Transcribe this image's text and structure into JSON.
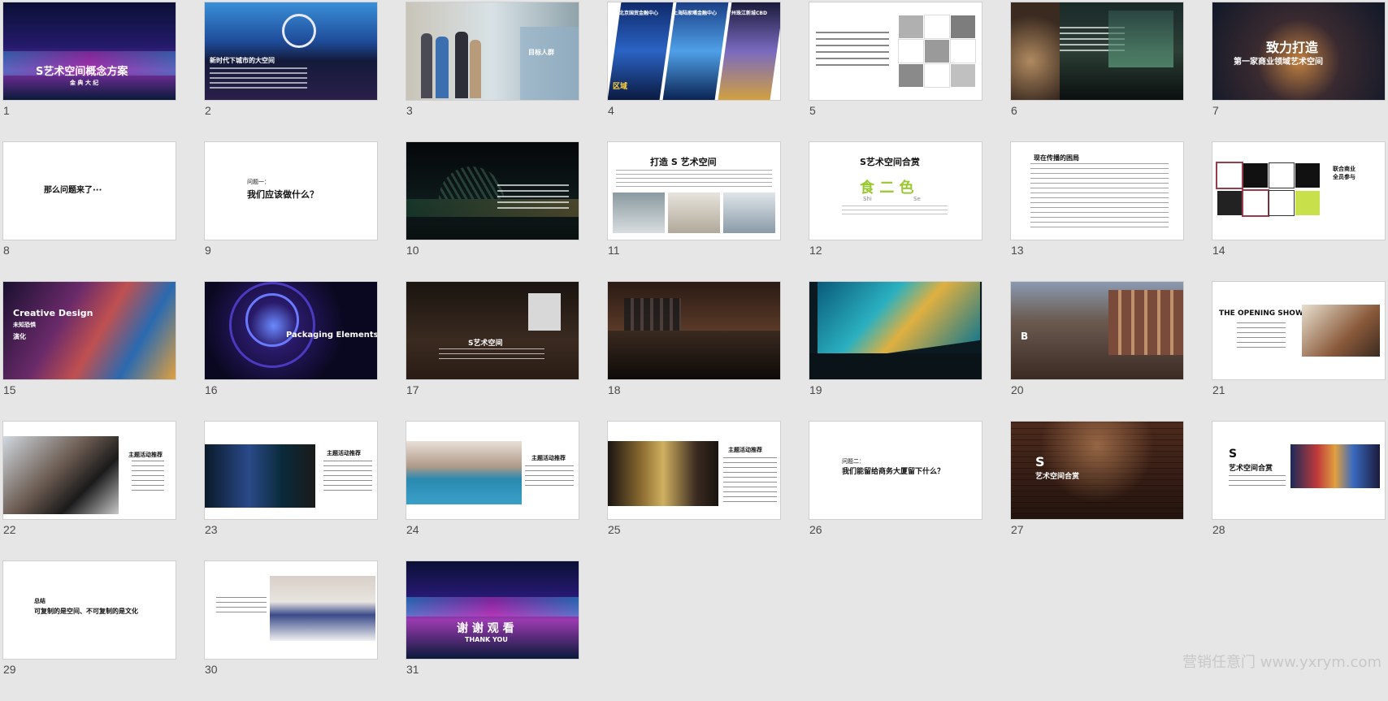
{
  "slides": [
    {
      "n": "1",
      "title": "S艺术空间概念方案",
      "sub": "金 典 大 纪"
    },
    {
      "n": "2",
      "title": "新时代下城市的大空间"
    },
    {
      "n": "3",
      "title": "目标人群"
    },
    {
      "n": "4",
      "title": "区域",
      "cols": [
        "北京国贸金融中心",
        "上海陆家嘴金融中心",
        "广州珠江新城CBD"
      ]
    },
    {
      "n": "5",
      "title": ""
    },
    {
      "n": "6",
      "title": ""
    },
    {
      "n": "7",
      "title": "致力打造",
      "sub": "第一家商业领域艺术空间"
    },
    {
      "n": "8",
      "title": "那么问题来了···"
    },
    {
      "n": "9",
      "title": "问题一：",
      "sub": "我们应该做什么？"
    },
    {
      "n": "10",
      "title": ""
    },
    {
      "n": "11",
      "title": "打造 S 艺术空间"
    },
    {
      "n": "12",
      "title": "S艺术空间合赏",
      "sub": "食 二 色",
      "a": "Shi",
      "b": "Se"
    },
    {
      "n": "13",
      "title": "现在传播的困局"
    },
    {
      "n": "14",
      "title": "联合商业",
      "sub": "全员参与"
    },
    {
      "n": "15",
      "title": "Creative Design",
      "sub": "未知恐惧",
      "c": "演化"
    },
    {
      "n": "16",
      "title": "Packaging Elements"
    },
    {
      "n": "17",
      "title": "S艺术空间"
    },
    {
      "n": "18",
      "title": ""
    },
    {
      "n": "19",
      "title": ""
    },
    {
      "n": "20",
      "title": "B"
    },
    {
      "n": "21",
      "title": "THE OPENING SHOW"
    },
    {
      "n": "22",
      "title": "主题活动推荐"
    },
    {
      "n": "23",
      "title": "主题活动推荐"
    },
    {
      "n": "24",
      "title": "主题活动推荐"
    },
    {
      "n": "25",
      "title": "主题活动推荐"
    },
    {
      "n": "26",
      "title": "问题二：",
      "sub": "我们能留给商务大厦留下什么？"
    },
    {
      "n": "27",
      "title": "S",
      "sub": "艺术空间合赏"
    },
    {
      "n": "28",
      "title": "S",
      "sub": "艺术空间合赏"
    },
    {
      "n": "29",
      "title": "总结",
      "sub": "可复制的是空间、不可复制的是文化"
    },
    {
      "n": "30",
      "title": ""
    },
    {
      "n": "31",
      "title": "谢 谢 观 看",
      "sub": "THANK YOU"
    }
  ],
  "watermark": "营销任意门 www.yxrym.com"
}
